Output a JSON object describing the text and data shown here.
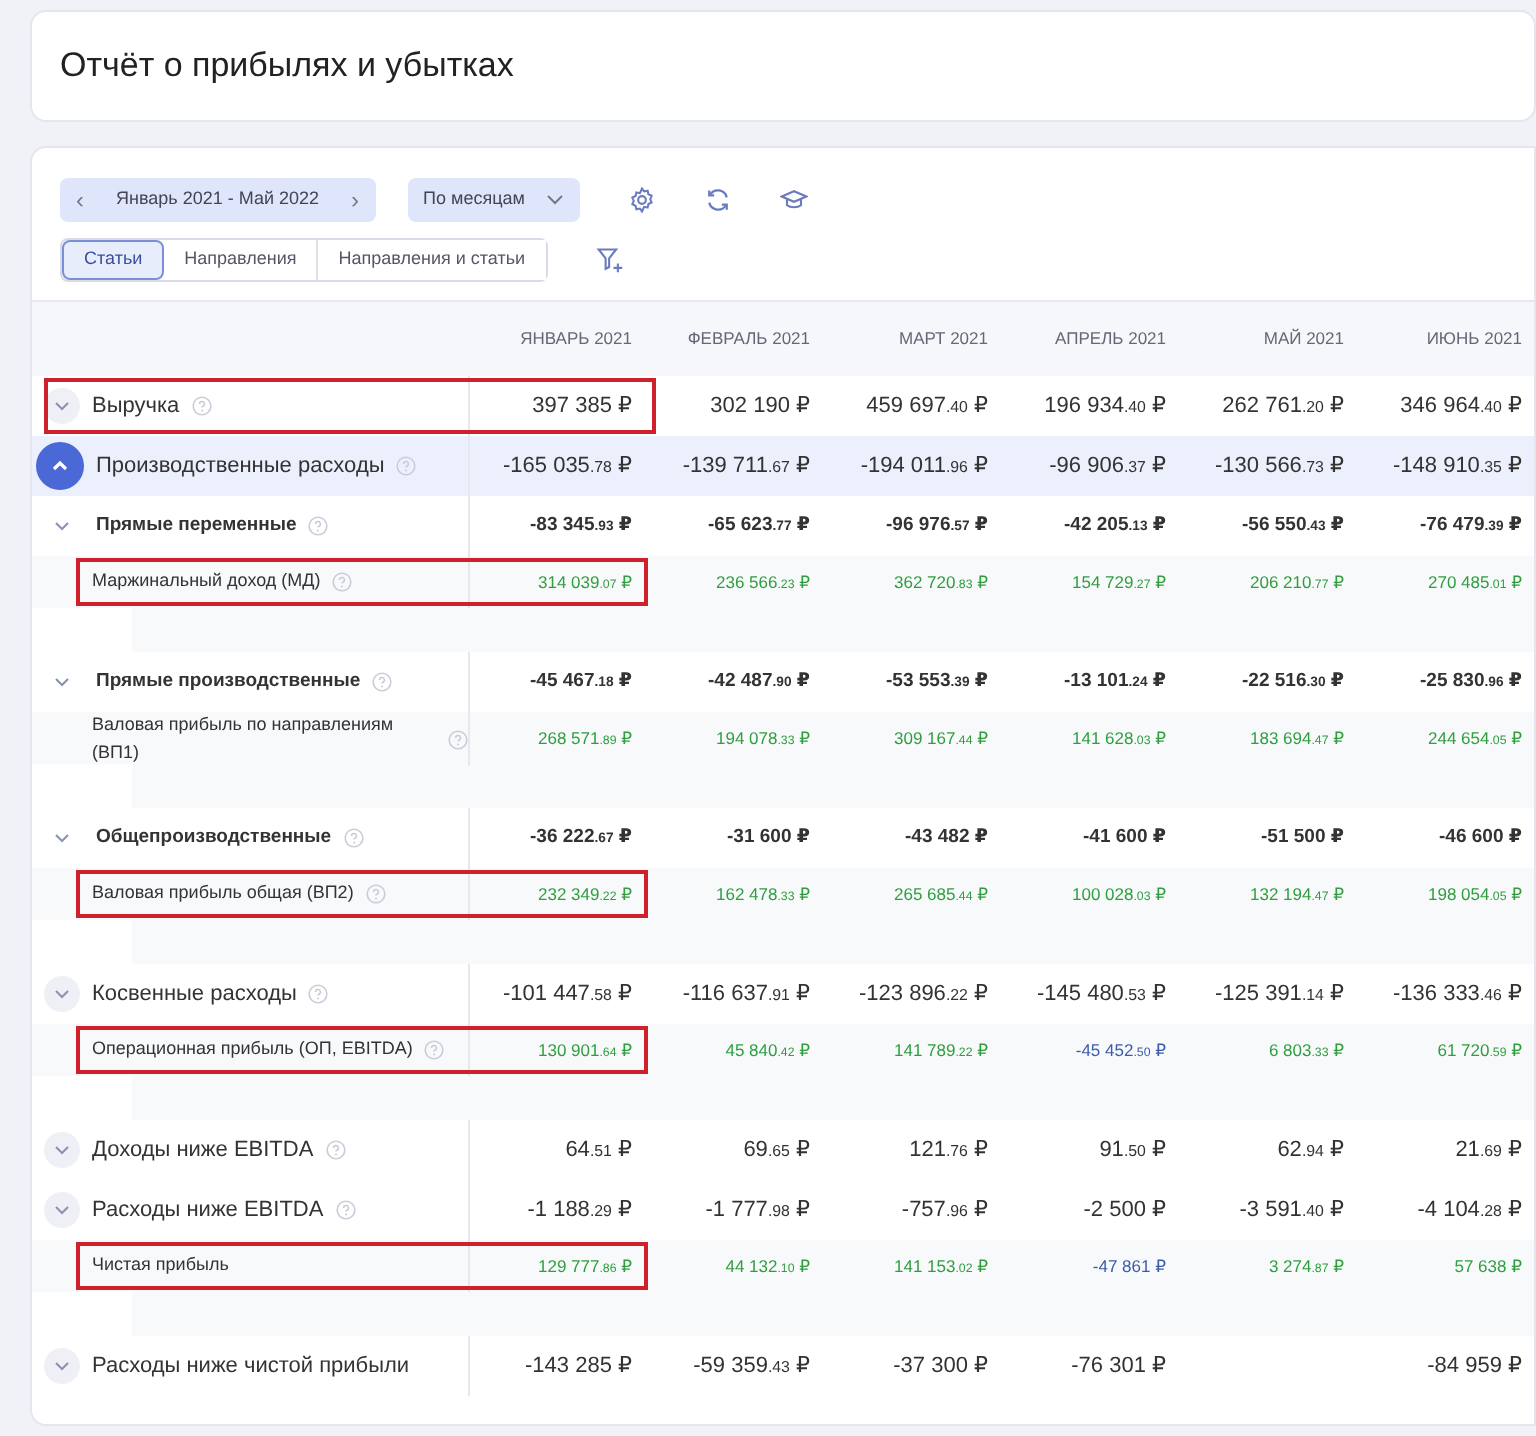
{
  "title": "Отчёт о прибылях и убытках",
  "toolbar": {
    "period": {
      "prev": "‹",
      "label": "Январь 2021 - Май 2022",
      "next": "›"
    },
    "grouping": "По месяцам"
  },
  "view_tabs": [
    {
      "label": "Статьи",
      "selected": true
    },
    {
      "label": "Направления",
      "selected": false
    },
    {
      "label": "Направления и статьи",
      "selected": false
    }
  ],
  "table": {
    "columns": [
      "ЯНВАРЬ 2021",
      "ФЕВРАЛЬ 2021",
      "МАРТ 2021",
      "АПРЕЛЬ 2021",
      "МАЙ 2021",
      "ИЮНЬ 2021"
    ],
    "rows": [
      {
        "kind": "group",
        "label": "Выручка",
        "info": true,
        "expanded": false,
        "highlighted": true,
        "cells": [
          {
            "text": "397 385 ₽"
          },
          {
            "text": "302 190 ₽"
          },
          {
            "text": "459 697.40 ₽"
          },
          {
            "text": "196 934.40 ₽"
          },
          {
            "text": "262 761.20 ₽"
          },
          {
            "text": "346 964.40 ₽"
          }
        ]
      },
      {
        "kind": "group",
        "label": "Производственные расходы",
        "info": true,
        "expanded": true,
        "highlighted": false,
        "cells": [
          {
            "text": "-165 035.78 ₽"
          },
          {
            "text": "-139 711.67 ₽"
          },
          {
            "text": "-194 011.96 ₽"
          },
          {
            "text": "-96 906.37 ₽"
          },
          {
            "text": "-130 566.73 ₽"
          },
          {
            "text": "-148 910.35 ₽"
          }
        ],
        "children": [
          {
            "kind": "sub",
            "label": "Прямые переменные",
            "info": true,
            "highlighted": false,
            "cells": [
              {
                "text": "-83 345.93 ₽"
              },
              {
                "text": "-65 623.77 ₽"
              },
              {
                "text": "-96 976.57 ₽"
              },
              {
                "text": "-42 205.13 ₽"
              },
              {
                "text": "-56 550.43 ₽"
              },
              {
                "text": "-76 479.39 ₽"
              }
            ],
            "children": [
              {
                "kind": "result",
                "label": "Маржинальный доход (МД)",
                "info": true,
                "highlighted": true,
                "cells": [
                  {
                    "text": "314 039.07 ₽",
                    "color": "#2e9e3e"
                  },
                  {
                    "text": "236 566.23 ₽",
                    "color": "#2e9e3e"
                  },
                  {
                    "text": "362 720.83 ₽",
                    "color": "#2e9e3e"
                  },
                  {
                    "text": "154 729.27 ₽",
                    "color": "#2e9e3e"
                  },
                  {
                    "text": "206 210.77 ₽",
                    "color": "#2e9e3e"
                  },
                  {
                    "text": "270 485.01 ₽",
                    "color": "#2e9e3e"
                  }
                ]
              }
            ]
          },
          {
            "kind": "sub",
            "label": "Прямые производственные",
            "info": true,
            "highlighted": false,
            "cells": [
              {
                "text": "-45 467.18 ₽"
              },
              {
                "text": "-42 487.90 ₽"
              },
              {
                "text": "-53 553.39 ₽"
              },
              {
                "text": "-13 101.24 ₽"
              },
              {
                "text": "-22 516.30 ₽"
              },
              {
                "text": "-25 830.96 ₽"
              }
            ],
            "children": [
              {
                "kind": "result",
                "label": "Валовая прибыль по направлениям (ВП1)",
                "info": true,
                "highlighted": false,
                "cells": [
                  {
                    "text": "268 571.89 ₽",
                    "color": "#2e9e3e"
                  },
                  {
                    "text": "194 078.33 ₽",
                    "color": "#2e9e3e"
                  },
                  {
                    "text": "309 167.44 ₽",
                    "color": "#2e9e3e"
                  },
                  {
                    "text": "141 628.03 ₽",
                    "color": "#2e9e3e"
                  },
                  {
                    "text": "183 694.47 ₽",
                    "color": "#2e9e3e"
                  },
                  {
                    "text": "244 654.05 ₽",
                    "color": "#2e9e3e"
                  }
                ]
              }
            ]
          },
          {
            "kind": "sub",
            "label": "Общепроизводственные",
            "info": true,
            "highlighted": false,
            "cells": [
              {
                "text": "-36 222.67 ₽"
              },
              {
                "text": "-31 600 ₽"
              },
              {
                "text": "-43 482 ₽"
              },
              {
                "text": "-41 600 ₽"
              },
              {
                "text": "-51 500 ₽"
              },
              {
                "text": "-46 600 ₽"
              }
            ]
          },
          {
            "kind": "result",
            "label": "Валовая прибыль общая (ВП2)",
            "info": true,
            "highlighted": true,
            "cells": [
              {
                "text": "232 349.22 ₽",
                "color": "#2e9e3e"
              },
              {
                "text": "162 478.33 ₽",
                "color": "#2e9e3e"
              },
              {
                "text": "265 685.44 ₽",
                "color": "#2e9e3e"
              },
              {
                "text": "100 028.03 ₽",
                "color": "#2e9e3e"
              },
              {
                "text": "132 194.47 ₽",
                "color": "#2e9e3e"
              },
              {
                "text": "198 054.05 ₽",
                "color": "#2e9e3e"
              }
            ]
          }
        ]
      },
      {
        "kind": "group",
        "label": "Косвенные расходы",
        "info": true,
        "expanded": false,
        "highlighted": false,
        "cells": [
          {
            "text": "-101 447.58 ₽"
          },
          {
            "text": "-116 637.91 ₽"
          },
          {
            "text": "-123 896.22 ₽"
          },
          {
            "text": "-145 480.53 ₽"
          },
          {
            "text": "-125 391.14 ₽"
          },
          {
            "text": "-136 333.46 ₽"
          }
        ]
      },
      {
        "kind": "result",
        "label": "Операционная прибыль (ОП, EBITDA)",
        "info": true,
        "highlighted": true,
        "cells": [
          {
            "text": "130 901.64 ₽",
            "color": "#2e9e3e"
          },
          {
            "text": "45 840.42 ₽",
            "color": "#2e9e3e"
          },
          {
            "text": "141 789.22 ₽",
            "color": "#2e9e3e"
          },
          {
            "text": "-45 452.50 ₽",
            "color": "#3b5bab"
          },
          {
            "text": "6 803.33 ₽",
            "color": "#2e9e3e"
          },
          {
            "text": "61 720.59 ₽",
            "color": "#2e9e3e"
          }
        ]
      },
      {
        "kind": "group",
        "label": "Доходы ниже EBITDA",
        "info": true,
        "expanded": false,
        "highlighted": false,
        "cells": [
          {
            "text": "64.51 ₽"
          },
          {
            "text": "69.65 ₽"
          },
          {
            "text": "121.76 ₽"
          },
          {
            "text": "91.50 ₽"
          },
          {
            "text": "62.94 ₽"
          },
          {
            "text": "21.69 ₽"
          }
        ]
      },
      {
        "kind": "group",
        "label": "Расходы ниже EBITDA",
        "info": true,
        "expanded": false,
        "highlighted": false,
        "cells": [
          {
            "text": "-1 188.29 ₽"
          },
          {
            "text": "-1 777.98 ₽"
          },
          {
            "text": "-757.96 ₽"
          },
          {
            "text": "-2 500 ₽"
          },
          {
            "text": "-3 591.40 ₽"
          },
          {
            "text": "-4 104.28 ₽"
          }
        ]
      },
      {
        "kind": "result",
        "label": "Чистая прибыль",
        "info": false,
        "highlighted": true,
        "cells": [
          {
            "text": "129 777.86 ₽",
            "color": "#2e9e3e"
          },
          {
            "text": "44 132.10 ₽",
            "color": "#2e9e3e"
          },
          {
            "text": "141 153.02 ₽",
            "color": "#2e9e3e"
          },
          {
            "text": "-47 861 ₽",
            "color": "#3b5bab"
          },
          {
            "text": "3 274.87 ₽",
            "color": "#2e9e3e"
          },
          {
            "text": "57 638 ₽",
            "color": "#2e9e3e"
          }
        ]
      },
      {
        "kind": "group",
        "label": "Расходы ниже чистой прибыли",
        "info": false,
        "expanded": false,
        "highlighted": false,
        "cells": [
          {
            "text": "-143 285 ₽"
          },
          {
            "text": "-59 359.43 ₽"
          },
          {
            "text": "-37 300 ₽"
          },
          {
            "text": "-76 301 ₽"
          },
          {
            "text": ""
          },
          {
            "text": "-84 959 ₽"
          }
        ]
      }
    ]
  }
}
